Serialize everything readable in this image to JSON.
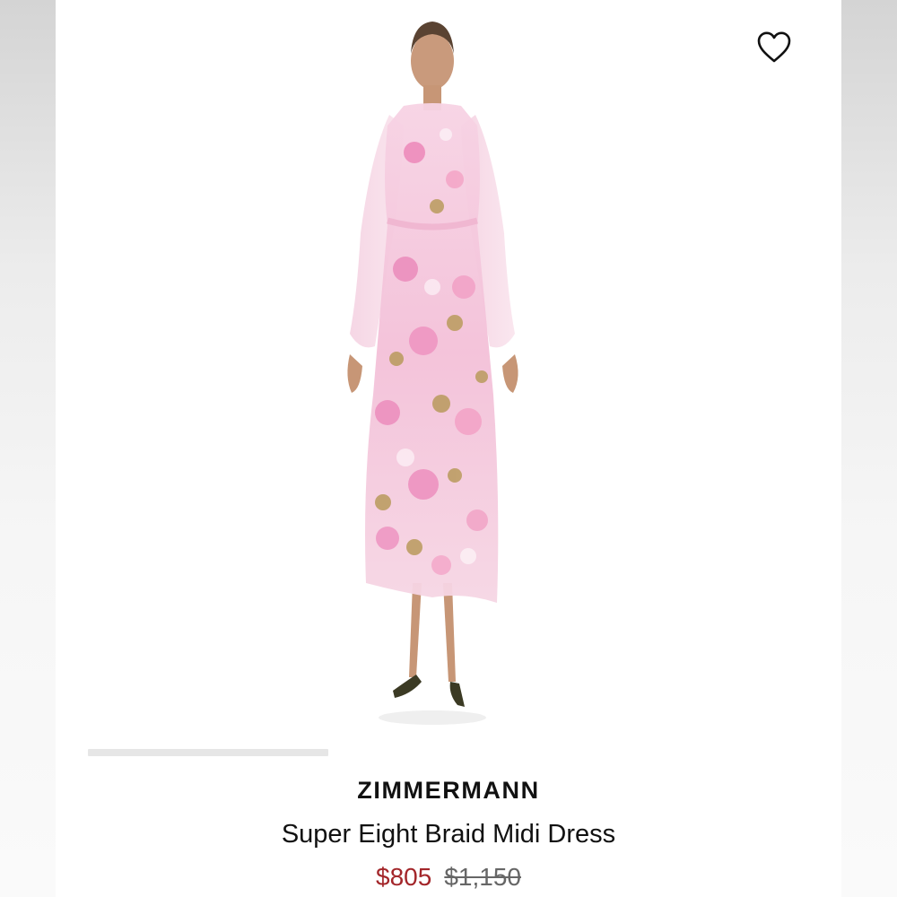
{
  "product": {
    "brand": "ZIMMERMANN",
    "name": "Super Eight Braid Midi Dress",
    "sale_price": "$805",
    "original_price": "$1,150"
  },
  "icons": {
    "wishlist": "heart-outline-icon"
  },
  "gallery": {
    "image_count_indicator": "scroll-track"
  },
  "colors": {
    "sale_price": "#a3262a",
    "original_price": "#666666",
    "text": "#111111",
    "dress_pink": "#f2a7cc",
    "dress_gold": "#b99a5c"
  }
}
